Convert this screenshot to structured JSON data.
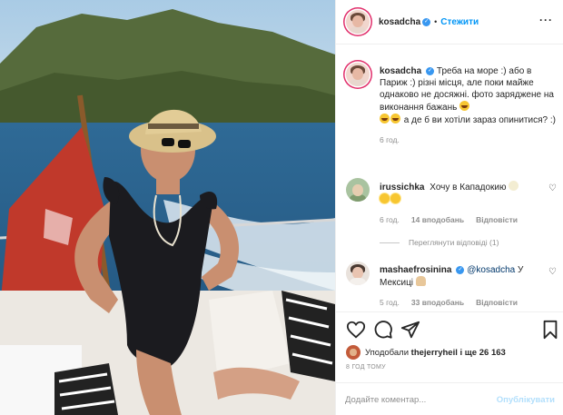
{
  "post": {
    "username": "kosadcha",
    "follow_label": "Стежити",
    "dot": "•",
    "more_icon": "more-horizontal-icon"
  },
  "caption": {
    "username": "kosadcha",
    "text": "Треба на море :) або в Париж :) різні місця, але поки майже однаково не досяжні. фото заряджене на виконання бажань",
    "text2": "а де б ви хотіли зараз опинитися? :)",
    "time": "6 год."
  },
  "comments": [
    {
      "username": "irussichka",
      "text": "Хочу в Кападокию",
      "time": "6 год.",
      "likes": "14 вподобань",
      "reply": "Відповісти",
      "view_replies": "Переглянути відповіді (1)"
    },
    {
      "username": "mashaefrosinina",
      "mention": "@kosadcha",
      "text": "У Мексиці",
      "time": "5 год.",
      "likes": "33 вподобань",
      "reply": "Відповісти"
    }
  ],
  "actions": {
    "liked_by_prefix": "Уподобали",
    "liked_by_user": "thejerryheil",
    "liked_by_suffix": "і ще 26 163",
    "time_ago": "8 ГОД ТОМУ",
    "comment_placeholder": "Додайте коментар...",
    "publish_label": "Опублікувати"
  },
  "colors": {
    "accent": "#0095f6",
    "verified": "#3897f0",
    "publish_disabled": "#b2dffc",
    "muted": "#8e8e8e"
  }
}
